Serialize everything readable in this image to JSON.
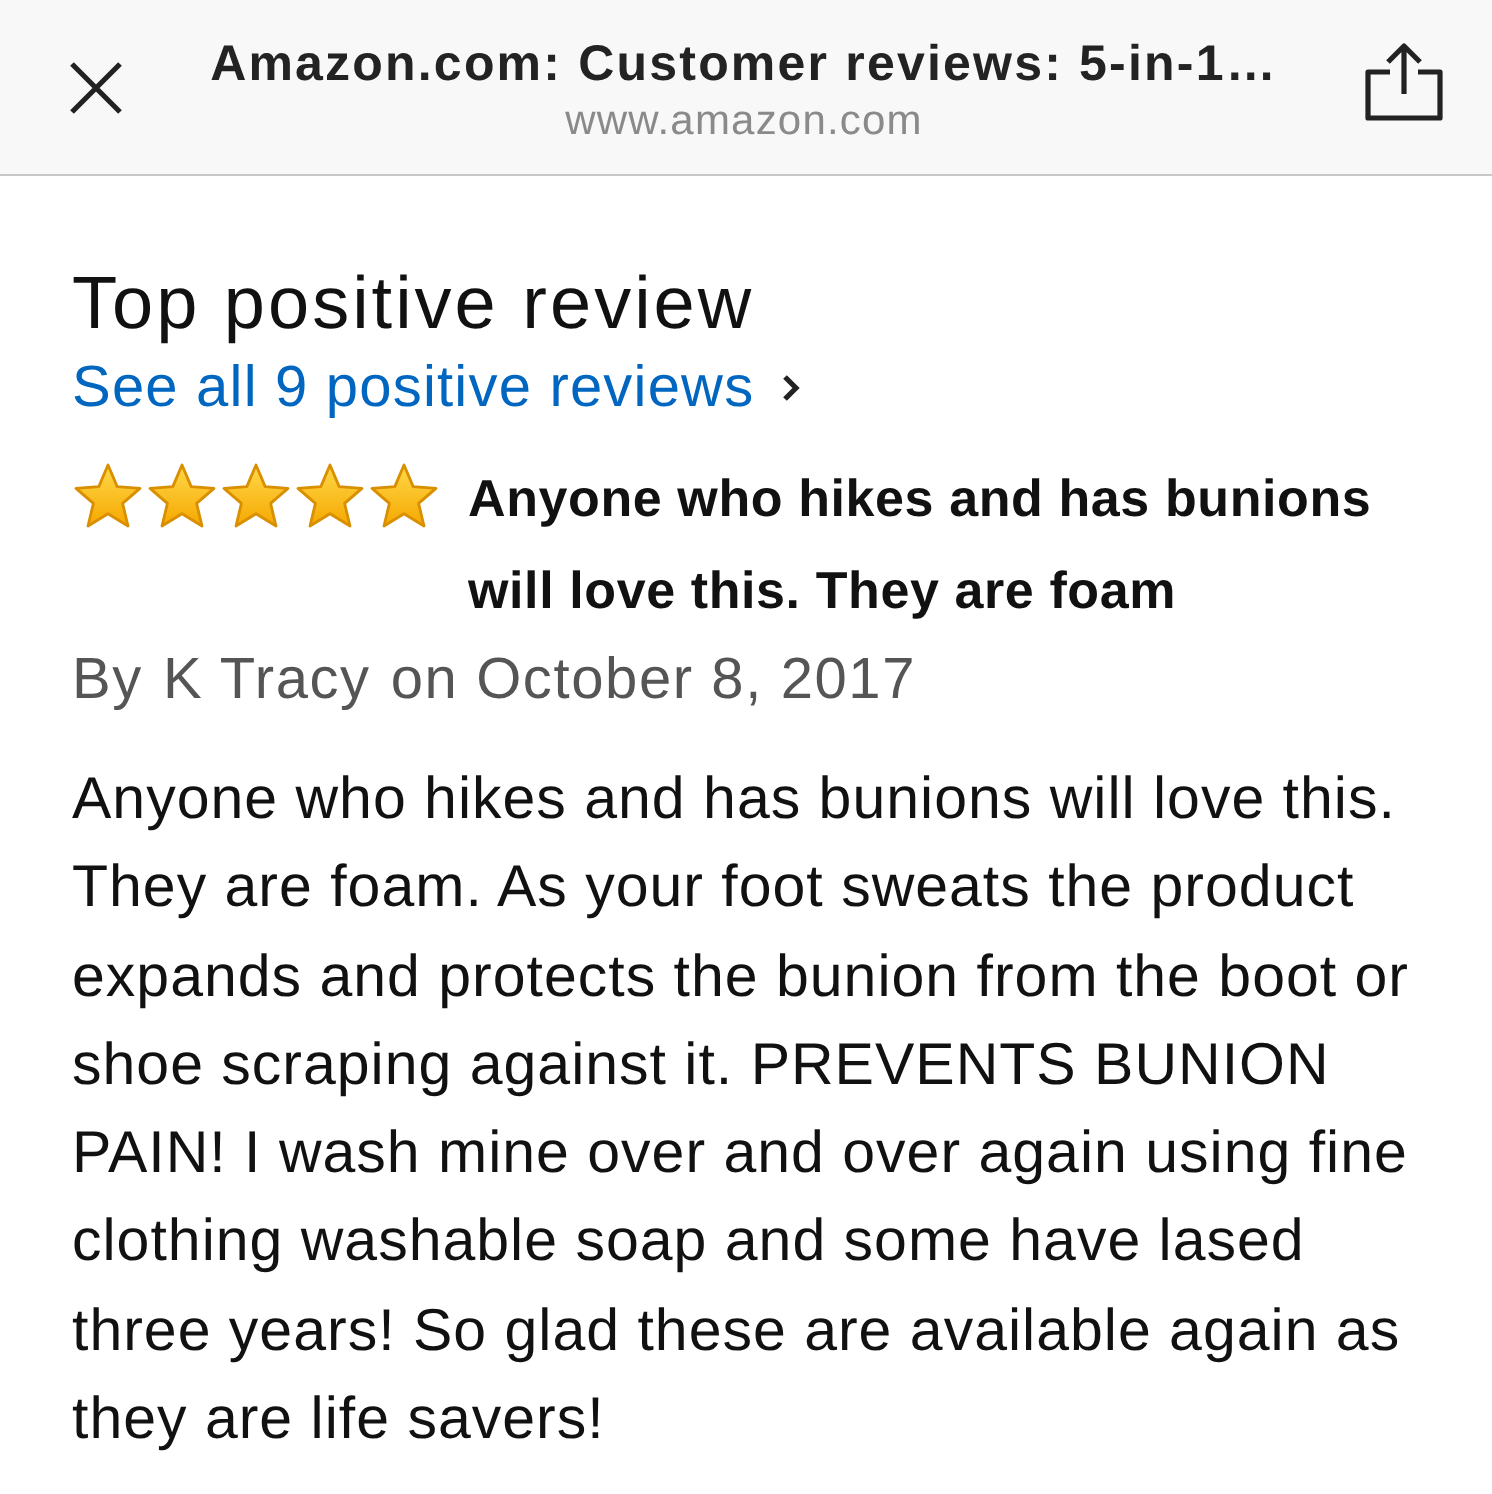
{
  "browser_bar": {
    "page_title": "Amazon.com: Customer reviews: 5-in-1…",
    "url": "www.amazon.com"
  },
  "section": {
    "heading": "Top positive review",
    "see_all_link": "See all 9 positive reviews"
  },
  "review": {
    "stars": 5,
    "title": "Anyone who hikes and has bunions will love this. They are foam",
    "by_label": "By",
    "author": "K Tracy",
    "date": "on October 8, 2017",
    "body": "Anyone who hikes and has bunions will love this. They are foam. As your foot sweats the product expands and protects the bunion from the boot or shoe scraping against it. PREVENTS BUNION PAIN! I wash mine over and over again using fine clothing washable soap and some have lased three years! So glad these are available again as they are life savers!"
  }
}
